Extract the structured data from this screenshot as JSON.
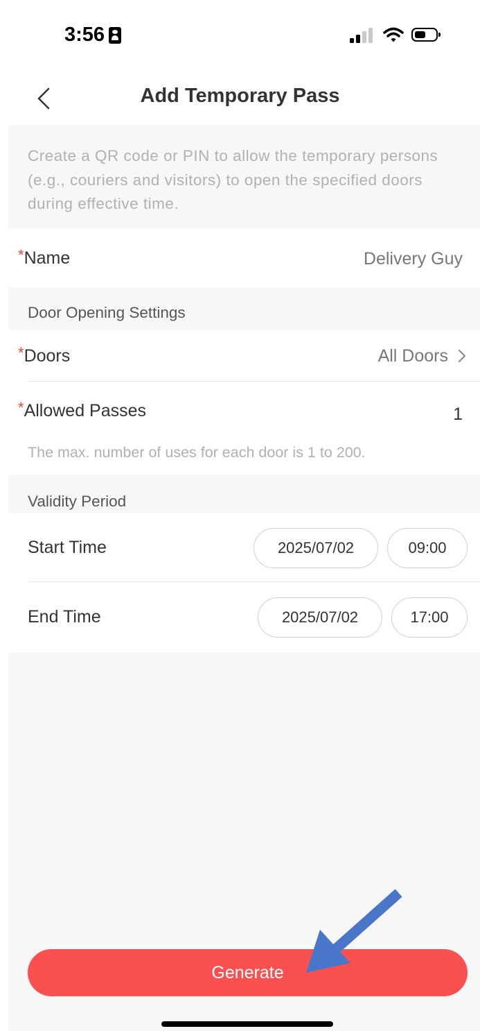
{
  "status_bar": {
    "time": "3:56"
  },
  "header": {
    "title": "Add Temporary Pass"
  },
  "description": "Create a QR code or PIN to allow the temporary persons (e.g., couriers and visitors) to open the specified doors during effective time.",
  "name_field": {
    "required_mark": "*",
    "label": "Name",
    "value": "Delivery Guy"
  },
  "door_settings": {
    "section_label": "Door Opening Settings",
    "doors": {
      "required_mark": "*",
      "label": "Doors",
      "value": "All Doors"
    },
    "allowed_passes": {
      "required_mark": "*",
      "label": "Allowed Passes",
      "value": "1",
      "hint": "The max. number of uses for each door is 1 to 200."
    }
  },
  "validity": {
    "section_label": "Validity Period",
    "start": {
      "label": "Start Time",
      "date": "2025/07/02",
      "time": "09:00"
    },
    "end": {
      "label": "End Time",
      "date": "2025/07/02",
      "time": "17:00"
    }
  },
  "actions": {
    "generate_label": "Generate"
  },
  "colors": {
    "accent": "#fa5150",
    "required": "#e8463f",
    "annotation_arrow": "#4a76c9",
    "section_background": "#f7f7f8"
  },
  "icons": {
    "back": "chevron-left-icon",
    "doors_chevron": "chevron-right-icon",
    "annotation": "arrow-icon"
  }
}
